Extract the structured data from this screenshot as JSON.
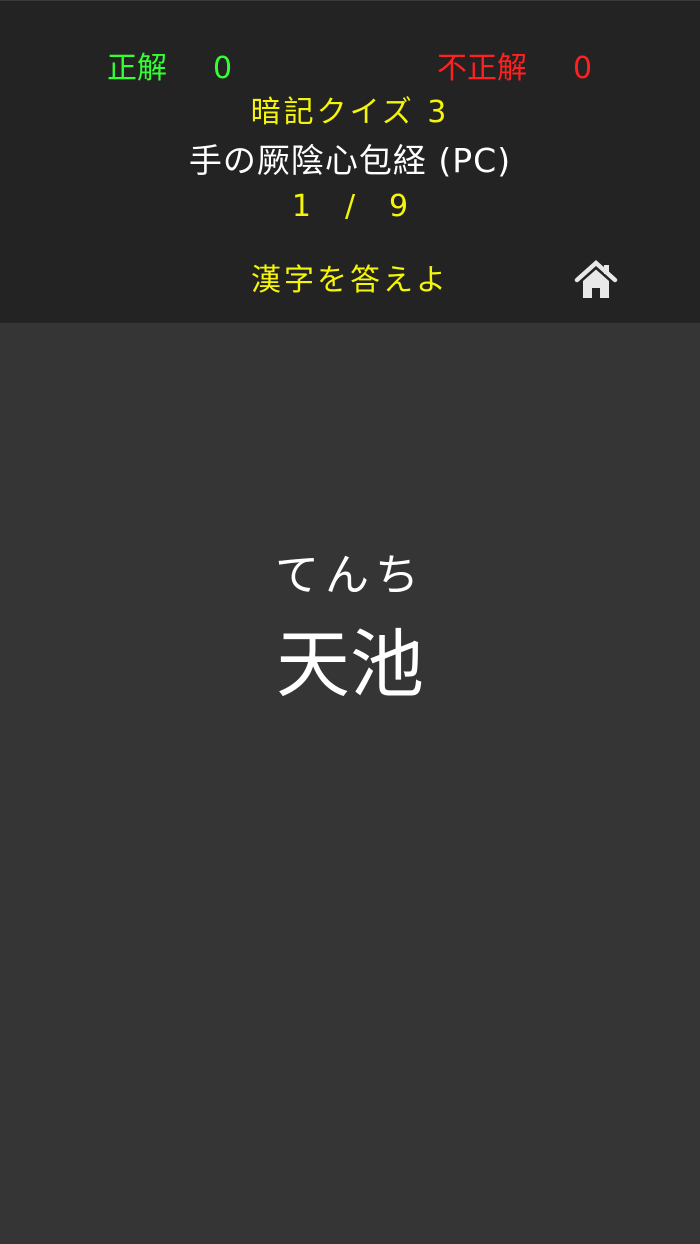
{
  "header": {
    "correct_label": "正解",
    "correct_count": "0",
    "wrong_label": "不正解",
    "wrong_count": "0",
    "quiz_title": "暗記クイズ 3",
    "quiz_subtitle": "手の厥陰心包経 (PC)",
    "progress_current": "1",
    "progress_separator": "/",
    "progress_total": "9",
    "instruction": "漢字を答えよ",
    "home_icon": "home-icon"
  },
  "question": {
    "reading": "てんち",
    "answer": "天池"
  },
  "colors": {
    "header_background": "#232323",
    "main_background": "#353535",
    "correct": "#33ff33",
    "wrong": "#ff2020",
    "accent_yellow": "#f5f50a",
    "text": "#ffffff"
  }
}
